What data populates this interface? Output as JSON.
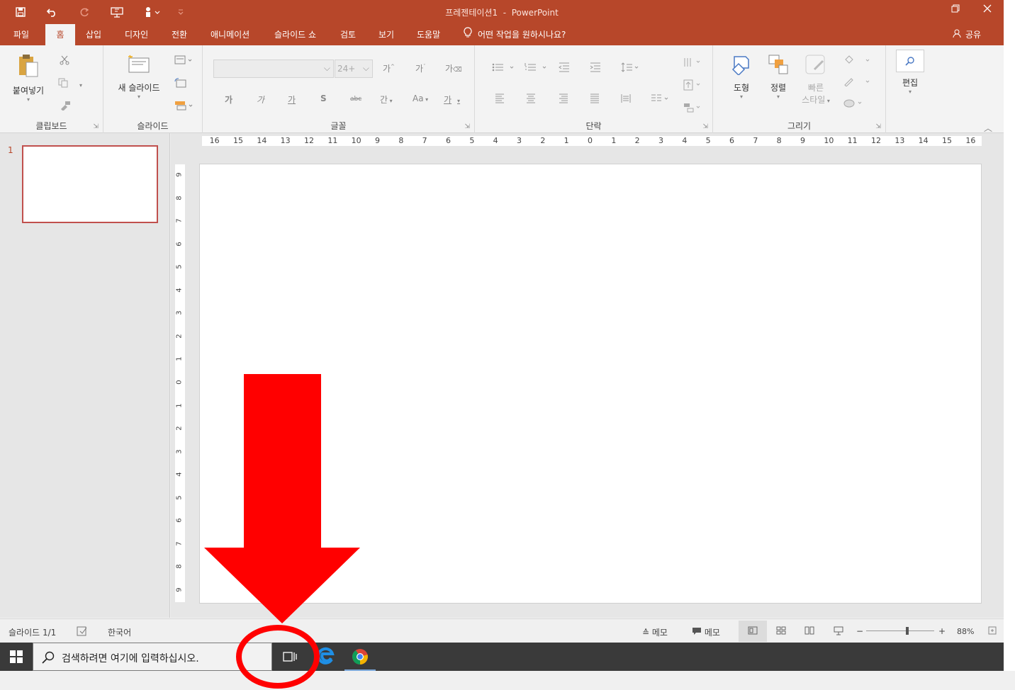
{
  "window": {
    "title": "프레젠테이션1",
    "app_name": "PowerPoint",
    "title_sep": "-"
  },
  "quick_access": [
    {
      "name": "save-icon"
    },
    {
      "name": "undo-icon"
    },
    {
      "name": "redo-icon"
    },
    {
      "name": "start-from-beginning-icon"
    },
    {
      "name": "touch-mouse-mode-icon"
    },
    {
      "name": "customize-qat-icon"
    }
  ],
  "tabs": [
    "파일",
    "홈",
    "삽입",
    "디자인",
    "전환",
    "애니메이션",
    "슬라이드 쇼",
    "검토",
    "보기",
    "도움말"
  ],
  "active_tab": "홈",
  "tell_me": "어떤 작업을 원하시나요?",
  "share": "공유",
  "ribbon": {
    "clipboard": {
      "label": "클립보드",
      "paste": "붙여넣기"
    },
    "slides": {
      "label": "슬라이드",
      "new_slide": "새 슬라이드"
    },
    "font": {
      "label": "글꼴",
      "font_size_placeholder": "24+",
      "buttons": [
        "가",
        "가",
        "가",
        "S",
        "abc",
        "간",
        "Aa",
        "가"
      ]
    },
    "paragraph": {
      "label": "단락"
    },
    "drawing": {
      "label": "그리기",
      "shapes": "도형",
      "arrange": "정렬",
      "quick_styles_1": "빠른",
      "quick_styles_2": "스타일"
    },
    "editing": {
      "label": "편집"
    }
  },
  "thumbnails": [
    {
      "number": "1"
    }
  ],
  "ruler": {
    "h_ticks": [
      "16",
      "15",
      "14",
      "13",
      "12",
      "11",
      "10",
      "9",
      "8",
      "7",
      "6",
      "5",
      "4",
      "3",
      "2",
      "1",
      "0",
      "1",
      "2",
      "3",
      "4",
      "5",
      "6",
      "7",
      "8",
      "9",
      "10",
      "11",
      "12",
      "13",
      "14",
      "15",
      "16"
    ],
    "v_ticks": [
      "9",
      "8",
      "7",
      "6",
      "5",
      "4",
      "3",
      "2",
      "1",
      "0",
      "1",
      "2",
      "3",
      "4",
      "5",
      "6",
      "7",
      "8",
      "9"
    ]
  },
  "statusbar": {
    "slide_info": "슬라이드 1/1",
    "language": "한국어",
    "notes": "메모",
    "comments": "메모",
    "zoom_minus": "−",
    "zoom_plus": "+",
    "zoom_percent": "88%",
    "zoom_level": 0.6
  },
  "taskbar": {
    "search_placeholder": "검색하려면 여기에 입력하십시오."
  },
  "colors": {
    "accent": "#b7472a",
    "annotation": "#ff0000"
  }
}
